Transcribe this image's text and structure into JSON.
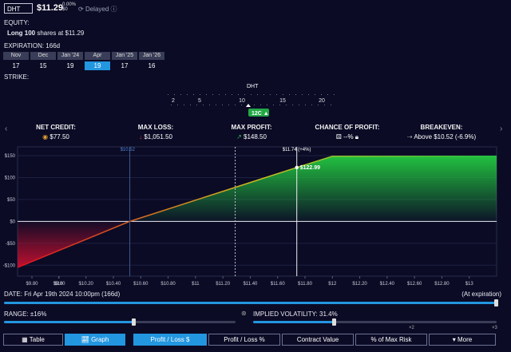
{
  "header": {
    "ticker": "DHT",
    "price": "$11.29",
    "change_pct": "0.00%",
    "change_abs": "$0",
    "delayed": "Delayed"
  },
  "equity": {
    "label": "EQUITY:",
    "position_prefix": "Long 100",
    "position_suffix": "shares at $11.29"
  },
  "expiration": {
    "label": "EXPIRATION: 166d",
    "items": [
      {
        "month": "Nov",
        "day": "17"
      },
      {
        "month": "Dec",
        "day": "15"
      },
      {
        "month": "Jan '24",
        "day": "19"
      },
      {
        "month": "Apr",
        "day": "19"
      },
      {
        "month": "Jan '25",
        "day": "17"
      },
      {
        "month": "Jan '26",
        "day": "16"
      }
    ],
    "selected_index": 3
  },
  "strike": {
    "label": "STRIKE:",
    "ticker": "DHT",
    "ticks": [
      "2",
      "5",
      "10",
      "15",
      "20"
    ],
    "chip": "12C"
  },
  "stats": {
    "net_credit": {
      "title": "NET CREDIT:",
      "value": "$77.50"
    },
    "max_loss": {
      "title": "MAX LOSS:",
      "value": "$1,051.50"
    },
    "max_profit": {
      "title": "MAX PROFIT:",
      "value": "$148.50"
    },
    "chance": {
      "title": "CHANCE OF PROFIT:",
      "value": "--%"
    },
    "breakeven": {
      "title": "BREAKEVEN:",
      "value": "Above $10.52 (-6.9%)"
    }
  },
  "chart_data": {
    "type": "area",
    "x": [
      9.7,
      10.52,
      11.74,
      12.0,
      13.2
    ],
    "y": [
      -105.0,
      0,
      122.99,
      148.5,
      148.5
    ],
    "xlim": [
      9.7,
      13.2
    ],
    "ylim": [
      -125,
      170
    ],
    "y_ticks": [
      "$150",
      "$100",
      "$50",
      "$0",
      "-$50",
      "-$100"
    ],
    "y_tick_values": [
      150,
      100,
      50,
      0,
      -50,
      -100
    ],
    "x_ticks": [
      "$9.80",
      "$9.80",
      "$10",
      "$10.20",
      "$10.40",
      "$10.60",
      "$10.80",
      "$11",
      "$11.20",
      "$11.40",
      "$11.60",
      "$11.80",
      "$12",
      "$12.20",
      "$12.40",
      "$12.60",
      "$12.80",
      "$13"
    ],
    "x_tick_values": [
      9.8,
      9.9,
      10.0,
      10.2,
      10.4,
      10.6,
      10.8,
      11.0,
      11.2,
      11.4,
      11.6,
      11.8,
      12.0,
      12.2,
      12.4,
      12.6,
      12.8,
      13.0
    ],
    "breakeven_x": 10.52,
    "breakeven_label": "$10.52",
    "current_price_x": 11.29,
    "marker_x": 11.74,
    "marker_label": "$11.74 (+4%)",
    "marker_value": "$122.99",
    "marker_y": 122.99,
    "colors": {
      "profit": "#22c040",
      "loss": "#d01030",
      "breakeven_line": "#3c5a8c"
    }
  },
  "date_slider": {
    "label": "DATE:",
    "value": "Fri Apr 19th 2024 10:00pm (166d)",
    "end_label": "(At expiration)",
    "position": 1.0
  },
  "range": {
    "label": "RANGE:",
    "value": "±16%",
    "position": 0.56
  },
  "iv": {
    "label": "IMPLIED VOLATILITY:",
    "value": "31.4%",
    "tick_x2": "×2",
    "tick_x3": "×3",
    "position": 0.33
  },
  "tabs": {
    "table": "Table",
    "graph": "Graph",
    "profit_loss_usd": "Profit / Loss $",
    "profit_loss_pct": "Profit / Loss %",
    "contract_value": "Contract Value",
    "pct_max_risk": "% of Max Risk",
    "more": "More"
  }
}
